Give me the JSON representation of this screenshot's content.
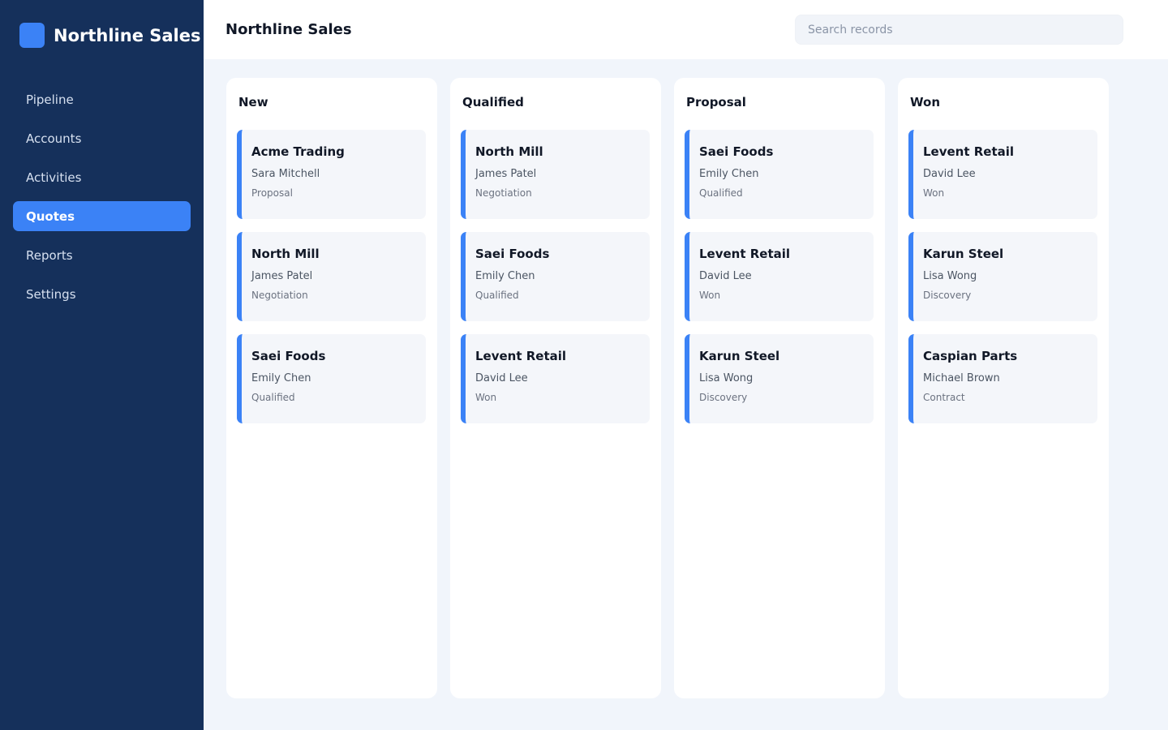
{
  "brand": {
    "name": "Northline Sales"
  },
  "nav": {
    "items": [
      {
        "label": "Pipeline",
        "active": false
      },
      {
        "label": "Accounts",
        "active": false
      },
      {
        "label": "Activities",
        "active": false
      },
      {
        "label": "Quotes",
        "active": true
      },
      {
        "label": "Reports",
        "active": false
      },
      {
        "label": "Settings",
        "active": false
      }
    ]
  },
  "header": {
    "title": "Northline Sales",
    "search_placeholder": "Search records",
    "search_value": ""
  },
  "colors": {
    "sidebar_bg": "#15305b",
    "accent": "#3b82f6",
    "page_bg": "#f1f5fb"
  },
  "board": {
    "columns": [
      {
        "title": "New",
        "cards": [
          {
            "company": "Acme Trading",
            "contact": "Sara Mitchell",
            "stage": "Proposal"
          },
          {
            "company": "North Mill",
            "contact": "James Patel",
            "stage": "Negotiation"
          },
          {
            "company": "Saei Foods",
            "contact": "Emily Chen",
            "stage": "Qualified"
          }
        ]
      },
      {
        "title": "Qualified",
        "cards": [
          {
            "company": "North Mill",
            "contact": "James Patel",
            "stage": "Negotiation"
          },
          {
            "company": "Saei Foods",
            "contact": "Emily Chen",
            "stage": "Qualified"
          },
          {
            "company": "Levent Retail",
            "contact": "David Lee",
            "stage": "Won"
          }
        ]
      },
      {
        "title": "Proposal",
        "cards": [
          {
            "company": "Saei Foods",
            "contact": "Emily Chen",
            "stage": "Qualified"
          },
          {
            "company": "Levent Retail",
            "contact": "David Lee",
            "stage": "Won"
          },
          {
            "company": "Karun Steel",
            "contact": "Lisa Wong",
            "stage": "Discovery"
          }
        ]
      },
      {
        "title": "Won",
        "cards": [
          {
            "company": "Levent Retail",
            "contact": "David Lee",
            "stage": "Won"
          },
          {
            "company": "Karun Steel",
            "contact": "Lisa Wong",
            "stage": "Discovery"
          },
          {
            "company": "Caspian Parts",
            "contact": "Michael Brown",
            "stage": "Contract"
          }
        ]
      }
    ]
  }
}
